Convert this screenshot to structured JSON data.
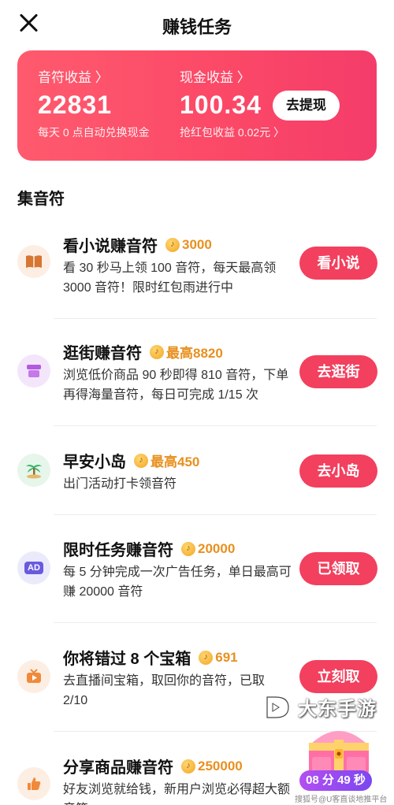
{
  "header": {
    "title": "赚钱任务"
  },
  "earnings": {
    "note_label": "音符收益 〉",
    "note_value": "22831",
    "note_sub": "每天 0 点自动兑换现金",
    "cash_label": "现金收益 〉",
    "cash_value": "100.34",
    "cash_sub": "抢红包收益 0.02元 〉",
    "withdraw_label": "去提现",
    "accent": "#f2405e"
  },
  "section": {
    "title": "集音符"
  },
  "tasks": [
    {
      "title": "看小说赚音符",
      "reward": "3000",
      "desc": "看 30 秒马上领 100 音符，每天最高领 3000 音符！限时红包雨进行中",
      "button": "看小说",
      "icon": "book-icon"
    },
    {
      "title": "逛街赚音符",
      "reward": "最高8820",
      "desc": "浏览低价商品 90 秒即得 810 音符，下单再得海量音符，每日可完成 1/15 次",
      "button": "去逛街",
      "icon": "shop-icon"
    },
    {
      "title": "早安小岛",
      "reward": "最高450",
      "desc": "出门活动打卡领音符",
      "button": "去小岛",
      "icon": "island-icon"
    },
    {
      "title": "限时任务赚音符",
      "reward": "20000",
      "desc": "每 5 分钟完成一次广告任务，单日最高可赚 20000 音符",
      "button": "已领取",
      "icon": "ad-icon"
    },
    {
      "title": "你将错过 8 个宝箱",
      "reward": "691",
      "desc": "去直播间宝箱，取回你的音符，已取 2/10",
      "button": "立刻取",
      "icon": "live-tv-icon"
    },
    {
      "title": "分享商品赚音符",
      "reward": "250000",
      "desc": "好友浏览就给钱，新用户浏览必得超大额音符",
      "button": "",
      "icon": "thumbs-up-icon"
    }
  ],
  "ad_icon_text": "AD",
  "watermark": {
    "text": "大东手游",
    "credit": "搜狐号@U客直谈地推平台"
  },
  "countdown": "08 分 49 秒"
}
